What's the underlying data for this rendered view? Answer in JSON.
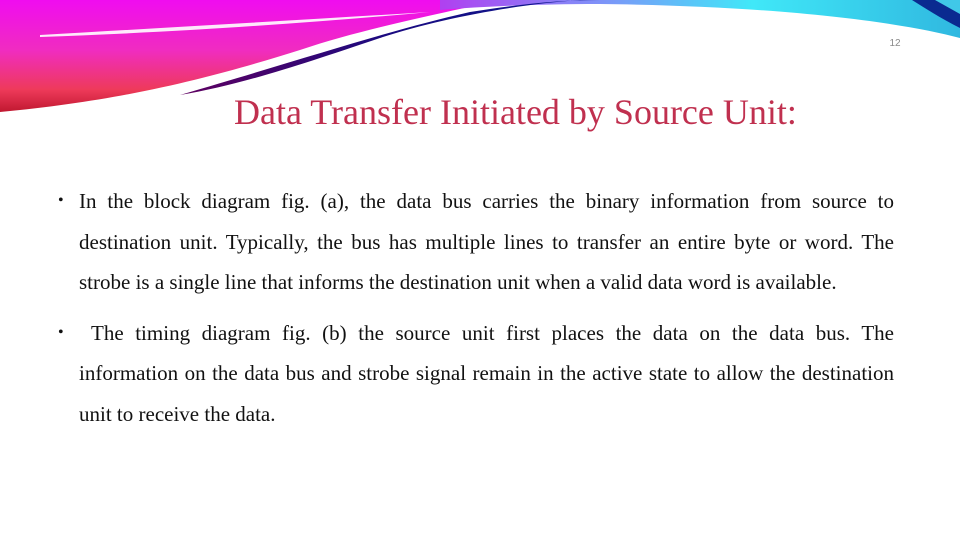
{
  "slide": {
    "number": "12",
    "title": "Data Transfer Initiated by Source Unit:",
    "title_color": "#c0304f",
    "decoration": "swoosh-banner",
    "bullets": [
      {
        "marker": "•",
        "text": "In the block diagram fig. (a), the data bus carries the binary information from source to destination unit. Typically, the bus has multiple lines to transfer an entire byte or word. The strobe is a single line that informs the destination unit when a valid data word is available."
      },
      {
        "marker": "•",
        "text": "The timing diagram fig. (b) the source unit first places the data on the data bus. The information on the data bus and strobe signal remain in the active state to allow the destination unit to receive the data."
      }
    ]
  },
  "colors": {
    "swoosh_magenta": "#f020e8",
    "swoosh_red": "#e8304a",
    "swoosh_navy": "#1a0a80",
    "swoosh_cyan": "#40e8f0"
  }
}
